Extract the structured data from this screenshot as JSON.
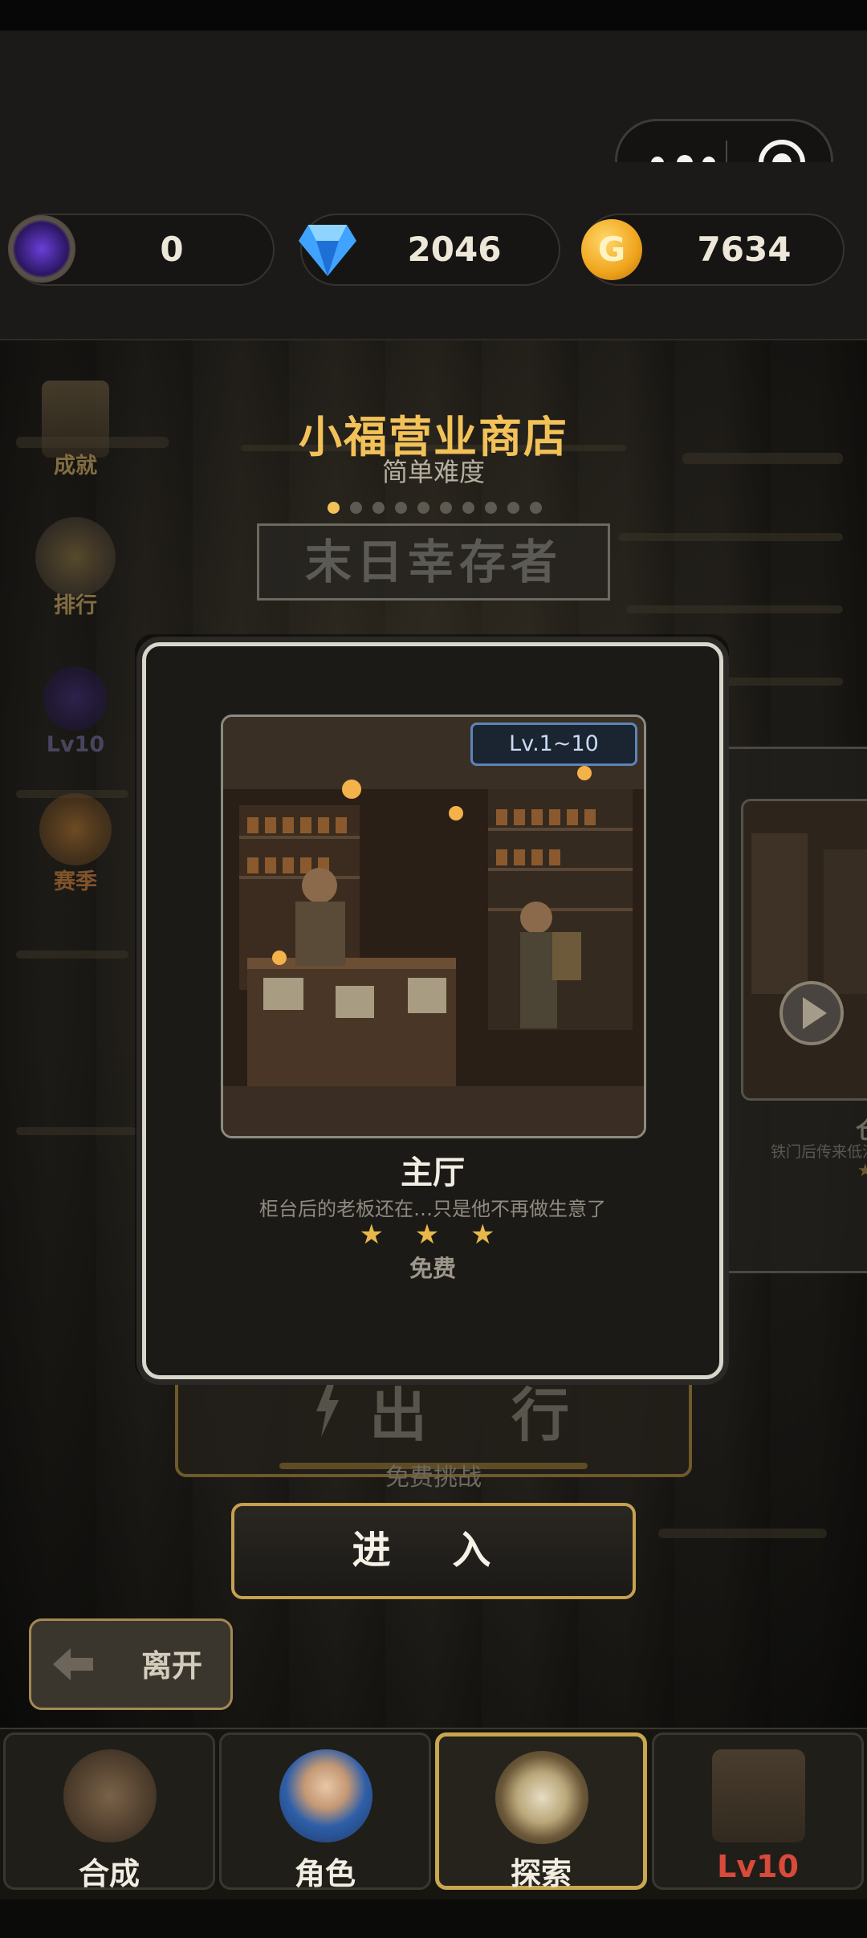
{
  "currency": {
    "gems_purple": "0",
    "diamonds": "2046",
    "gold": "7634"
  },
  "header_icons": {
    "more": "more-dots-icon",
    "close": "target-icon"
  },
  "side_menu": [
    {
      "label": "成就",
      "icon": "scroll-icon"
    },
    {
      "label": "排行",
      "icon": "trophy-icon"
    },
    {
      "label": "Lv10",
      "icon": "portal-icon"
    },
    {
      "label": "赛季",
      "icon": "star-badge-icon"
    }
  ],
  "shop": {
    "title": "小福营业商店",
    "difficulty": "简单难度",
    "page_count": 10,
    "current_page": 1,
    "scene_title": "末日幸存者"
  },
  "card": {
    "level_badge": "Lv.1~10",
    "name": "主厅",
    "description": "柜台后的老板还在…只是他不再做生意了",
    "stars": "★ ★ ★",
    "price": "免费"
  },
  "next_card": {
    "name_partial": "仓",
    "description_partial": "铁门后传来低沉",
    "stars_partial": "★"
  },
  "go": {
    "label": "出 行",
    "sub": "免费挑战"
  },
  "enter_label": "进 入",
  "leave_label": "离开",
  "tabs": [
    {
      "label": "合成",
      "icon": "crafting-tools-icon",
      "active": false
    },
    {
      "label": "角色",
      "icon": "character-avatar-icon",
      "active": false
    },
    {
      "label": "探索",
      "icon": "compass-icon",
      "active": true
    },
    {
      "label": "Lv10",
      "icon": "locked-shop-icon",
      "active": false
    }
  ],
  "colors": {
    "accent_gold": "#f2c259",
    "locked_red": "#d84a3a",
    "badge_blue": "#5d84b8"
  }
}
